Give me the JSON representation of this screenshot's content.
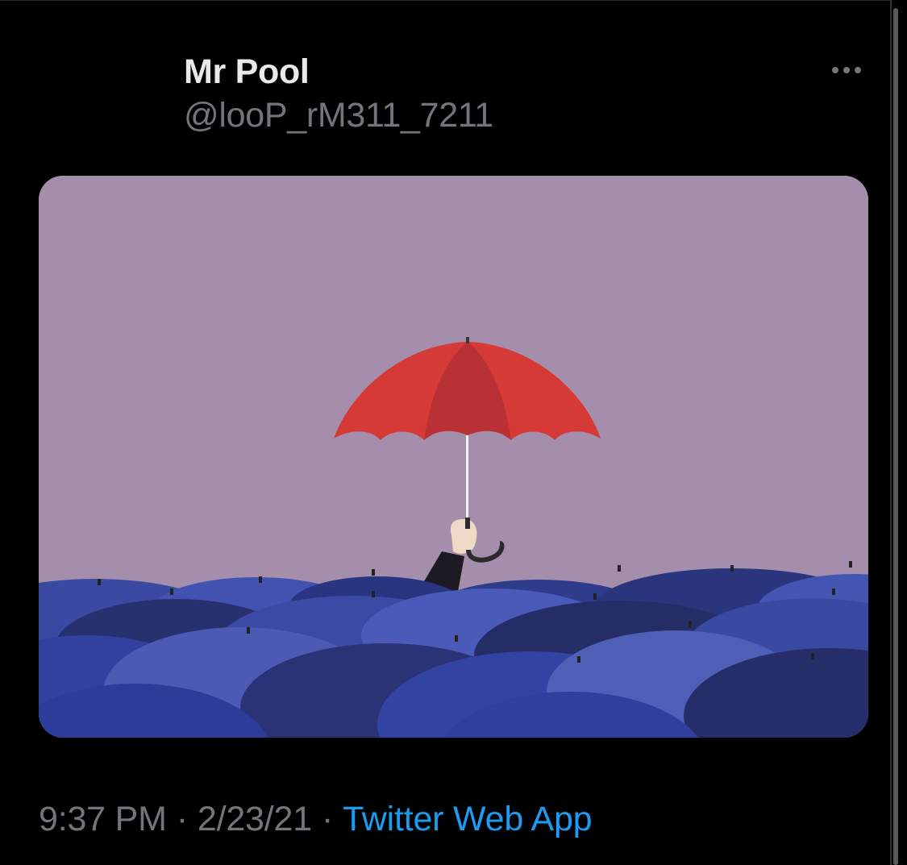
{
  "tweet": {
    "author": {
      "display_name": "Mr Pool",
      "handle": "@looP_rM311_7211"
    },
    "more_icon": "more-horizontal-icon",
    "media": {
      "background_color": "#a58eac",
      "accent_umbrella_color": "#d63a37",
      "crowd_umbrella_color": "#3a4a9e"
    },
    "meta": {
      "time": "9:37 PM",
      "separator": "·",
      "date": "2/23/21",
      "source": "Twitter Web App",
      "source_color": "#1d9bf0"
    }
  },
  "colors": {
    "background": "#000000",
    "primary_text": "#e7e9ea",
    "secondary_text": "#71767b",
    "link": "#1d9bf0"
  }
}
